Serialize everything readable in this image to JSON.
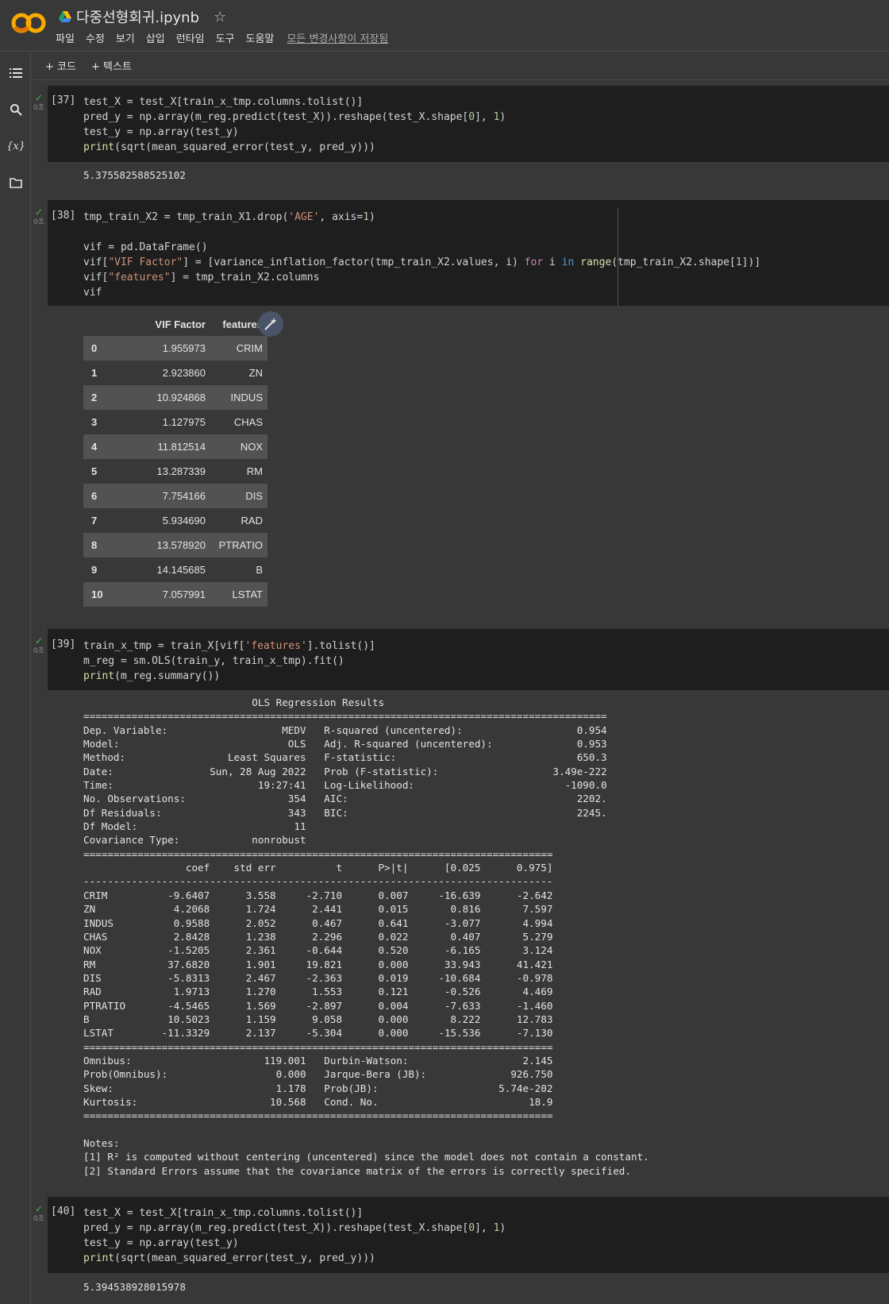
{
  "header": {
    "title": "다중선형회귀.ipynb",
    "menu": [
      "파일",
      "수정",
      "보기",
      "삽입",
      "런타임",
      "도구",
      "도움말"
    ],
    "saved_status": "모든 변경사항이 저장됨",
    "logo_text": "CO"
  },
  "toolbar": {
    "add_code": "+ 코드",
    "add_text": "+ 텍스트"
  },
  "sidebar": {
    "icons": [
      "table-of-contents-icon",
      "search-icon",
      "variables-icon",
      "folder-icon"
    ],
    "variables_glyph": "{x}"
  },
  "cells": [
    {
      "count": "[37]",
      "time": "0초",
      "output": "5.375582588525102"
    },
    {
      "count": "[38]",
      "time": "0초",
      "table": {
        "columns": [
          "VIF Factor",
          "features"
        ],
        "rows": [
          [
            "0",
            "1.955973",
            "CRIM"
          ],
          [
            "1",
            "2.923860",
            "ZN"
          ],
          [
            "2",
            "10.924868",
            "INDUS"
          ],
          [
            "3",
            "1.127975",
            "CHAS"
          ],
          [
            "4",
            "11.812514",
            "NOX"
          ],
          [
            "5",
            "13.287339",
            "RM"
          ],
          [
            "6",
            "7.754166",
            "DIS"
          ],
          [
            "7",
            "5.934690",
            "RAD"
          ],
          [
            "8",
            "13.578920",
            "PTRATIO"
          ],
          [
            "9",
            "14.145685",
            "B"
          ],
          [
            "10",
            "7.057991",
            "LSTAT"
          ]
        ]
      }
    },
    {
      "count": "[39]",
      "time": "0초"
    },
    {
      "count": "[40]",
      "time": "0초",
      "output": "5.394538928015978"
    }
  ],
  "ols_summary": "                            OLS Regression Results                                \n=======================================================================================\nDep. Variable:                   MEDV   R-squared (uncentered):                   0.954\nModel:                            OLS   Adj. R-squared (uncentered):              0.953\nMethod:                 Least Squares   F-statistic:                              650.3\nDate:                Sun, 28 Aug 2022   Prob (F-statistic):                   3.49e-222\nTime:                        19:27:41   Log-Likelihood:                         -1090.0\nNo. Observations:                 354   AIC:                                      2202.\nDf Residuals:                     343   BIC:                                      2245.\nDf Model:                          11                                                  \nCovariance Type:            nonrobust                                                  \n==============================================================================\n                 coef    std err          t      P>|t|      [0.025      0.975]\n------------------------------------------------------------------------------\nCRIM          -9.6407      3.558     -2.710      0.007     -16.639      -2.642\nZN             4.2068      1.724      2.441      0.015       0.816       7.597\nINDUS          0.9588      2.052      0.467      0.641      -3.077       4.994\nCHAS           2.8428      1.238      2.296      0.022       0.407       5.279\nNOX           -1.5205      2.361     -0.644      0.520      -6.165       3.124\nRM            37.6820      1.901     19.821      0.000      33.943      41.421\nDIS           -5.8313      2.467     -2.363      0.019     -10.684      -0.978\nRAD            1.9713      1.270      1.553      0.121      -0.526       4.469\nPTRATIO       -4.5465      1.569     -2.897      0.004      -7.633      -1.460\nB             10.5023      1.159      9.058      0.000       8.222      12.783\nLSTAT        -11.3329      2.137     -5.304      0.000     -15.536      -7.130\n==============================================================================\nOmnibus:                      119.001   Durbin-Watson:                   2.145\nProb(Omnibus):                  0.000   Jarque-Bera (JB):              926.750\nSkew:                           1.178   Prob(JB):                    5.74e-202\nKurtosis:                      10.568   Cond. No.                         18.9\n==============================================================================\n\nNotes:\n[1] R² is computed without centering (uncentered) since the model does not contain a constant.\n[2] Standard Errors assume that the covariance matrix of the errors is correctly specified."
}
